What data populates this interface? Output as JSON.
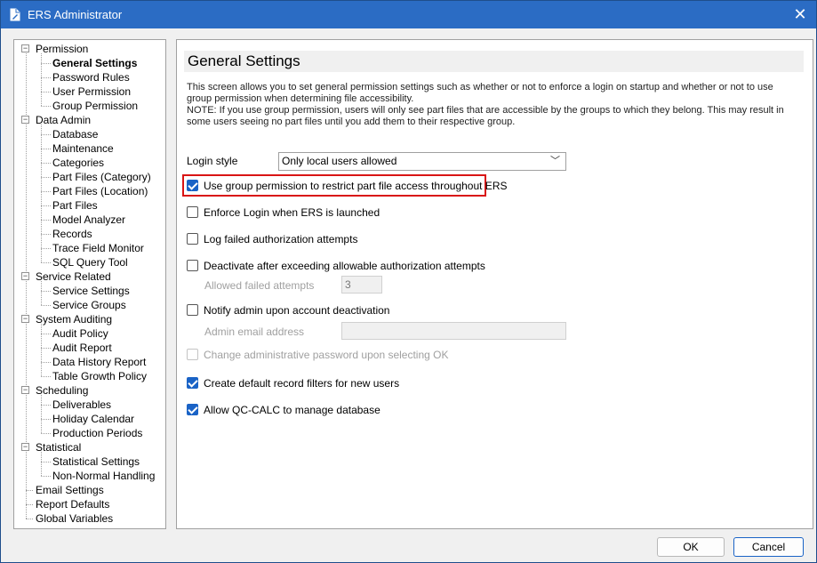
{
  "window": {
    "title": "ERS Administrator",
    "close_glyph": "✕",
    "icon": "document-edit-icon"
  },
  "tree": {
    "expander_glyph": "−",
    "items": [
      {
        "label": "Permission",
        "level": 0,
        "expander": true
      },
      {
        "label": "General Settings",
        "level": 1,
        "selected": true
      },
      {
        "label": "Password Rules",
        "level": 1
      },
      {
        "label": "User Permission",
        "level": 1
      },
      {
        "label": "Group Permission",
        "level": 1
      },
      {
        "label": "Data Admin",
        "level": 0,
        "expander": true
      },
      {
        "label": "Database",
        "level": 1
      },
      {
        "label": "Maintenance",
        "level": 1
      },
      {
        "label": "Categories",
        "level": 1
      },
      {
        "label": "Part Files (Category)",
        "level": 1
      },
      {
        "label": "Part Files (Location)",
        "level": 1
      },
      {
        "label": "Part Files",
        "level": 1
      },
      {
        "label": "Model Analyzer",
        "level": 1
      },
      {
        "label": "Records",
        "level": 1
      },
      {
        "label": "Trace Field Monitor",
        "level": 1
      },
      {
        "label": "SQL Query Tool",
        "level": 1
      },
      {
        "label": "Service Related",
        "level": 0,
        "expander": true
      },
      {
        "label": "Service Settings",
        "level": 1
      },
      {
        "label": "Service Groups",
        "level": 1
      },
      {
        "label": "System Auditing",
        "level": 0,
        "expander": true
      },
      {
        "label": "Audit Policy",
        "level": 1
      },
      {
        "label": "Audit Report",
        "level": 1
      },
      {
        "label": "Data History Report",
        "level": 1
      },
      {
        "label": "Table Growth Policy",
        "level": 1
      },
      {
        "label": "Scheduling",
        "level": 0,
        "expander": true
      },
      {
        "label": "Deliverables",
        "level": 1
      },
      {
        "label": "Holiday Calendar",
        "level": 1
      },
      {
        "label": "Production Periods",
        "level": 1
      },
      {
        "label": "Statistical",
        "level": 0,
        "expander": true
      },
      {
        "label": "Statistical Settings",
        "level": 1
      },
      {
        "label": "Non-Normal Handling",
        "level": 1
      },
      {
        "label": "Email Settings",
        "level": 0
      },
      {
        "label": "Report Defaults",
        "level": 0
      },
      {
        "label": "Global Variables",
        "level": 0
      }
    ]
  },
  "content": {
    "title": "General Settings",
    "description_1": "This screen allows you to set general permission settings such as whether or not to enforce a login on startup and whether or not to use group permission when determining file accessibility.",
    "description_2": "NOTE: If you use group permission, users will only see part files that are accessible by the groups to which they belong. This may result in some users seeing no part files until you add them to their respective group.",
    "login_style_label": "Login style",
    "login_style_value": "Only local users allowed",
    "chevron_glyph": "﹀",
    "use_group_permission": {
      "label": "Use group permission to restrict part file access throughout ERS",
      "checked": true
    },
    "enforce_login": {
      "label": "Enforce Login when ERS is launched",
      "checked": false
    },
    "log_failed": {
      "label": "Log failed authorization attempts",
      "checked": false
    },
    "deactivate": {
      "label": "Deactivate after exceeding allowable authorization attempts",
      "checked": false
    },
    "allowed_failed_label": "Allowed failed attempts",
    "allowed_failed_value": "3",
    "notify_admin": {
      "label": "Notify admin upon account deactivation",
      "checked": false
    },
    "admin_email_label": "Admin email address",
    "admin_email_value": "",
    "change_password": {
      "label": "Change administrative password upon selecting OK",
      "checked": false,
      "disabled": true
    },
    "create_filters": {
      "label": "Create default record filters for new users",
      "checked": true
    },
    "allow_qc_calc": {
      "label": "Allow QC-CALC to manage database",
      "checked": true
    }
  },
  "buttons": {
    "ok": "OK",
    "cancel": "Cancel"
  },
  "colors": {
    "titlebar": "#2b6cc4",
    "accent": "#1a63c6",
    "highlight_border": "#d91414"
  }
}
